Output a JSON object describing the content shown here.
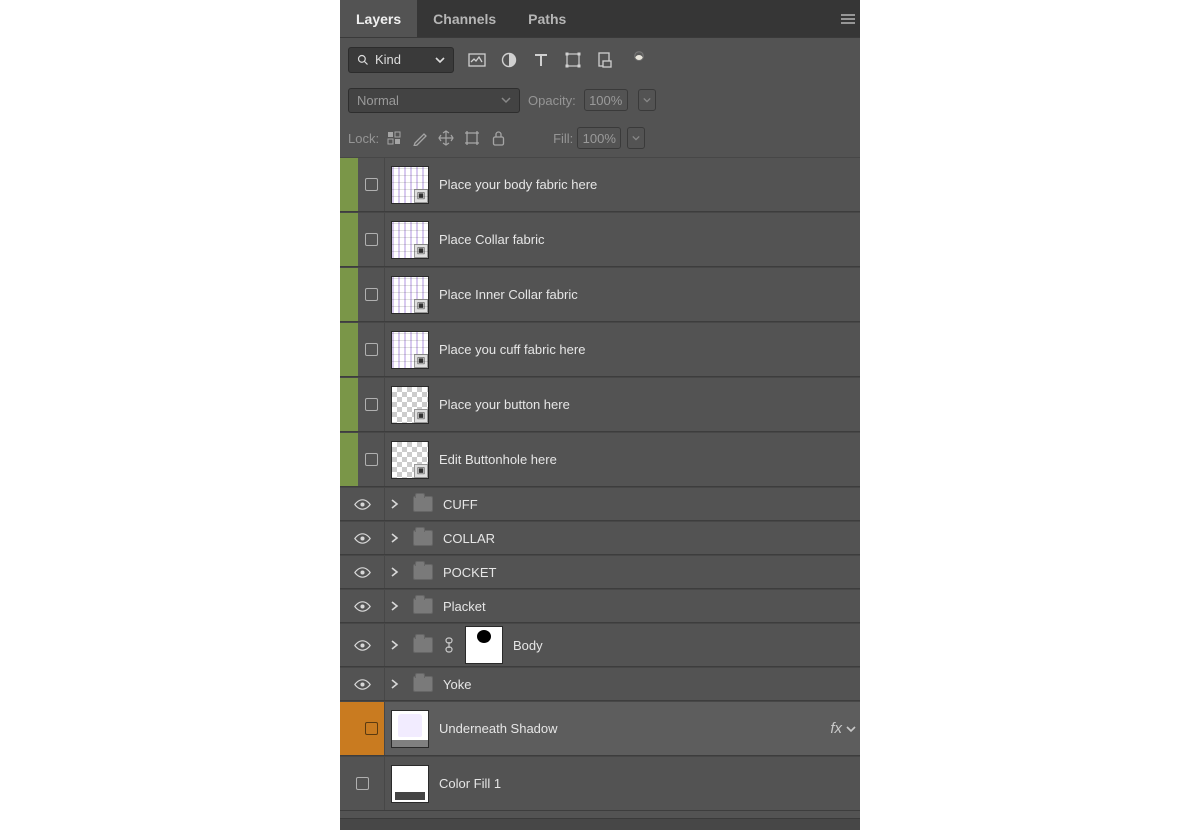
{
  "tabs": {
    "layers": "Layers",
    "channels": "Channels",
    "paths": "Paths"
  },
  "filter": {
    "label": "Kind"
  },
  "blend": {
    "mode": "Normal",
    "opacity_label": "Opacity:",
    "opacity": "100%",
    "lock_label": "Lock:",
    "fill_label": "Fill:",
    "fill": "100%"
  },
  "layers": [
    {
      "kind": "smart",
      "stripe": "green",
      "vis": "box",
      "thumb": "striped",
      "name": "Place your body fabric here"
    },
    {
      "kind": "smart",
      "stripe": "green",
      "vis": "box",
      "thumb": "striped",
      "name": "Place Collar fabric"
    },
    {
      "kind": "smart",
      "stripe": "green",
      "vis": "box",
      "thumb": "striped",
      "name": "Place Inner Collar fabric"
    },
    {
      "kind": "smart",
      "stripe": "green",
      "vis": "box",
      "thumb": "striped",
      "name": "Place you cuff fabric here"
    },
    {
      "kind": "smart",
      "stripe": "green",
      "vis": "box",
      "thumb": "checker",
      "name": "Place your button here"
    },
    {
      "kind": "smart",
      "stripe": "green",
      "vis": "box",
      "thumb": "checker",
      "name": "Edit Buttonhole here"
    },
    {
      "kind": "group",
      "stripe": "none",
      "vis": "eye",
      "name": "CUFF"
    },
    {
      "kind": "group",
      "stripe": "none",
      "vis": "eye",
      "name": "COLLAR"
    },
    {
      "kind": "group",
      "stripe": "none",
      "vis": "eye",
      "name": "POCKET"
    },
    {
      "kind": "group",
      "stripe": "none",
      "vis": "eye",
      "name": "Placket"
    },
    {
      "kind": "group-mask",
      "stripe": "none",
      "vis": "eye",
      "name": "Body"
    },
    {
      "kind": "group",
      "stripe": "none",
      "vis": "eye",
      "name": "Yoke"
    },
    {
      "kind": "smart",
      "stripe": "orange",
      "selected": true,
      "vis": "box",
      "thumb": "shadow",
      "name": "Underneath Shadow",
      "fx": "fx"
    },
    {
      "kind": "plain",
      "stripe": "none",
      "vis": "box",
      "thumb": "colorfill",
      "name": "Color Fill 1"
    }
  ]
}
